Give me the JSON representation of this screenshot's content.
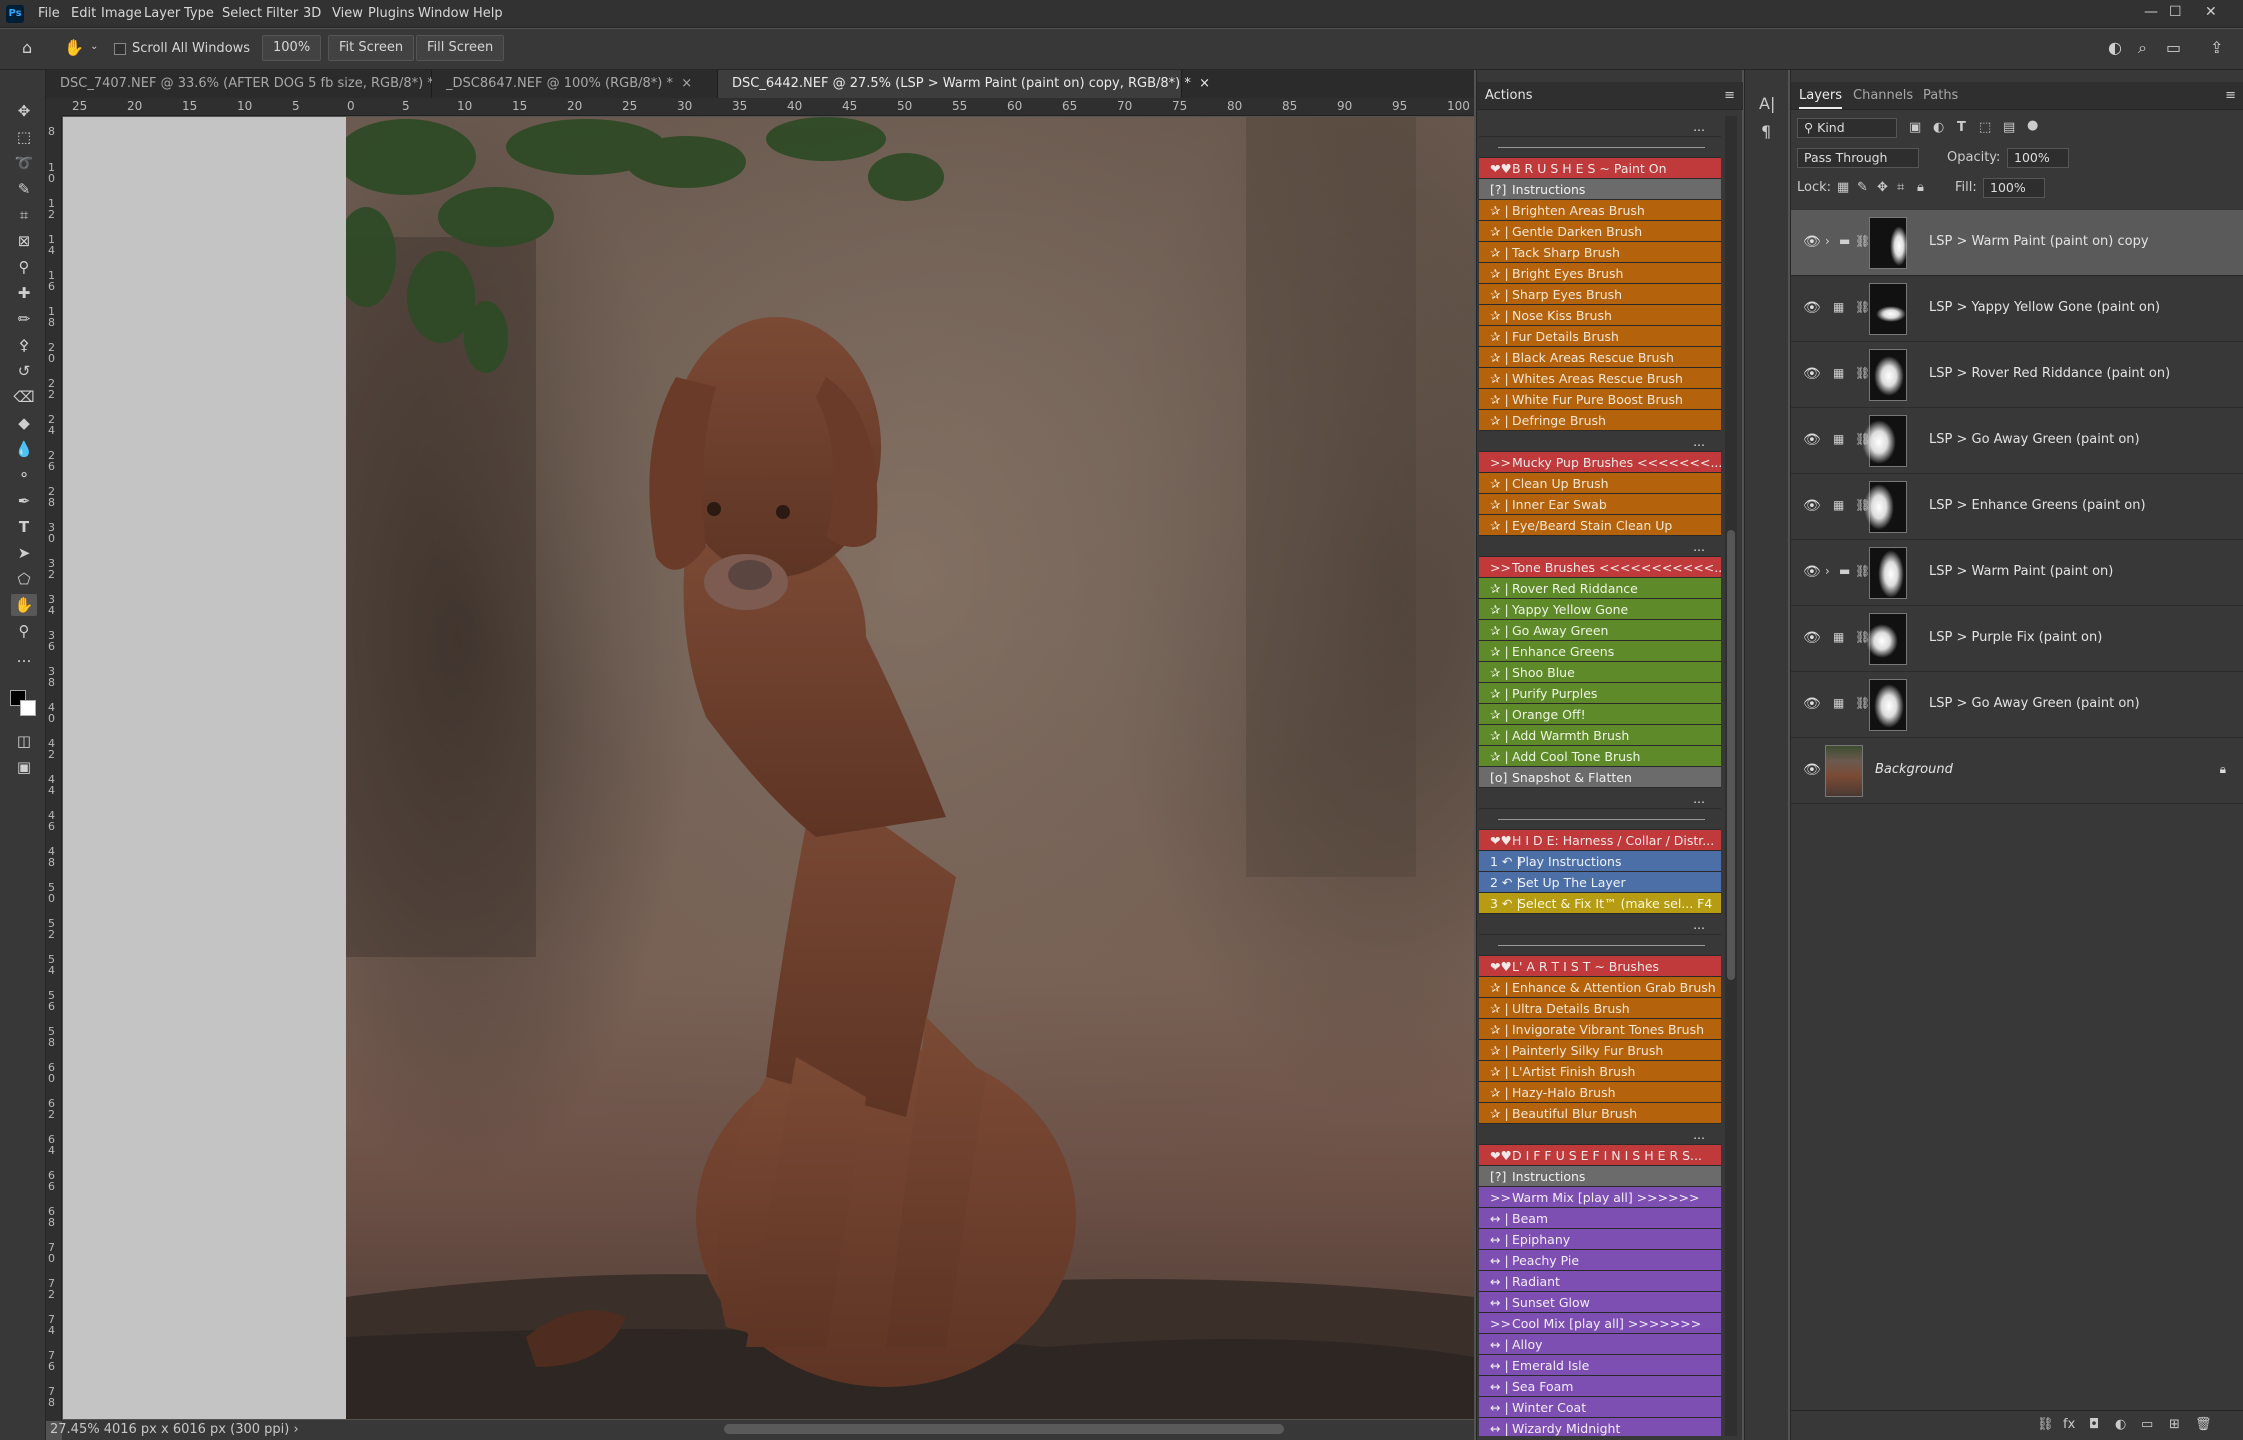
{
  "menu": [
    "File",
    "Edit",
    "Image",
    "Layer",
    "Type",
    "Select",
    "Filter",
    "3D",
    "View",
    "Plugins",
    "Window",
    "Help"
  ],
  "options": {
    "scroll_all_windows": "Scroll All Windows",
    "zoom": "100%",
    "fit_screen": "Fit Screen",
    "fill_screen": "Fill Screen"
  },
  "tabs": [
    {
      "label": "DSC_7407.NEF @ 33.6% (AFTER DOG 5 fb size, RGB/8*) *",
      "close": "×",
      "active": false
    },
    {
      "label": "_DSC8647.NEF @ 100% (RGB/8*) *",
      "close": "×",
      "active": false
    },
    {
      "label": "DSC_6442.NEF @ 27.5% (LSP > Warm Paint (paint on) copy, RGB/8*) *",
      "close": "×",
      "active": true
    }
  ],
  "ruler_h": [
    "25",
    "20",
    "15",
    "10",
    "5",
    "0",
    "5",
    "10",
    "15",
    "20",
    "25",
    "30",
    "35",
    "40",
    "45",
    "50",
    "55",
    "60",
    "65",
    "70",
    "75",
    "80",
    "85",
    "90",
    "95",
    "100"
  ],
  "ruler_v": [
    "8",
    "1 0",
    "1 2",
    "1 4",
    "1 6",
    "1 8",
    "2 0",
    "2 2",
    "2 4",
    "2 6",
    "2 8",
    "3 0",
    "3 2",
    "3 4",
    "3 6",
    "3 8",
    "4 0",
    "4 2",
    "4 4",
    "4 6",
    "4 8",
    "5 0",
    "5 2",
    "5 4",
    "5 6",
    "5 8",
    "6 0",
    "6 2",
    "6 4",
    "6 6",
    "6 8",
    "7 0",
    "7 2",
    "7 4",
    "7 6",
    "7 8"
  ],
  "status": {
    "zoom": "27.45%",
    "dimensions": "4016 px x 6016 px (300 ppi)",
    "arrow": "›"
  },
  "actions": {
    "title": "Actions",
    "rows": [
      {
        "c": "dots",
        "t": "...",
        "k": ""
      },
      {
        "c": "line",
        "t": "",
        "k": ""
      },
      {
        "c": "red",
        "k": "❤♥",
        "t": "B R U S H E S  ~ Paint On"
      },
      {
        "c": "gray",
        "k": "[?]",
        "t": "Instructions"
      },
      {
        "c": "orange",
        "k": "✰ |",
        "t": "Brighten Areas Brush"
      },
      {
        "c": "orange",
        "k": "✰ |",
        "t": "Gentle Darken Brush"
      },
      {
        "c": "orange",
        "k": "✰ |",
        "t": "Tack Sharp Brush"
      },
      {
        "c": "orange",
        "k": "✰ |",
        "t": "Bright Eyes Brush"
      },
      {
        "c": "orange",
        "k": "✰ |",
        "t": "Sharp Eyes Brush"
      },
      {
        "c": "orange",
        "k": "✰ |",
        "t": "Nose Kiss Brush"
      },
      {
        "c": "orange",
        "k": "✰ |",
        "t": "Fur Details Brush"
      },
      {
        "c": "orange",
        "k": "✰ |",
        "t": "Black Areas Rescue Brush"
      },
      {
        "c": "orange",
        "k": "✰ |",
        "t": "Whites Areas Rescue Brush"
      },
      {
        "c": "orange",
        "k": "✰ |",
        "t": "White Fur Pure Boost Brush"
      },
      {
        "c": "orange",
        "k": "✰ |",
        "t": "Defringe Brush"
      },
      {
        "c": "dots",
        "t": "...",
        "k": ""
      },
      {
        "c": "red",
        "k": ">>",
        "t": "Mucky Pup Brushes <<<<<<<..."
      },
      {
        "c": "orange",
        "k": "✰ |",
        "t": "Clean Up Brush"
      },
      {
        "c": "orange",
        "k": "✰ |",
        "t": "Inner Ear Swab"
      },
      {
        "c": "orange",
        "k": "✰ |",
        "t": "Eye/Beard Stain Clean Up"
      },
      {
        "c": "dots",
        "t": "...",
        "k": ""
      },
      {
        "c": "red",
        "k": ">>",
        "t": "Tone Brushes <<<<<<<<<<<..."
      },
      {
        "c": "green",
        "k": "✰ |",
        "t": "Rover Red Riddance"
      },
      {
        "c": "green",
        "k": "✰ |",
        "t": "Yappy Yellow Gone"
      },
      {
        "c": "green",
        "k": "✰ |",
        "t": "Go Away Green"
      },
      {
        "c": "green",
        "k": "✰ |",
        "t": "Enhance Greens"
      },
      {
        "c": "green",
        "k": "✰ |",
        "t": "Shoo Blue"
      },
      {
        "c": "green",
        "k": "✰ |",
        "t": "Purify Purples"
      },
      {
        "c": "green",
        "k": "✰ |",
        "t": "Orange Off!"
      },
      {
        "c": "green",
        "k": "✰ |",
        "t": "Add Warmth Brush"
      },
      {
        "c": "green",
        "k": "✰ |",
        "t": "Add Cool Tone Brush"
      },
      {
        "c": "gray",
        "k": "[o]",
        "t": "Snapshot & Flatten"
      },
      {
        "c": "dots",
        "t": "...",
        "k": ""
      },
      {
        "c": "line",
        "t": "",
        "k": ""
      },
      {
        "c": "red",
        "k": "❤♥",
        "t": "H I D E: Harness / Collar / Distr..."
      },
      {
        "c": "blue",
        "k": "1 ↶ |",
        "t": "Play Instructions"
      },
      {
        "c": "blue",
        "k": "2 ↶ |",
        "t": "Set Up The Layer"
      },
      {
        "c": "yellow",
        "k": "3 ↶ |",
        "t": "Select & Fix It™ (make sel...      F4"
      },
      {
        "c": "dots",
        "t": "...",
        "k": ""
      },
      {
        "c": "line",
        "t": "",
        "k": ""
      },
      {
        "c": "red",
        "k": "❤♥",
        "t": "L' A R T I S T  ~ Brushes"
      },
      {
        "c": "orange",
        "k": "✰ |",
        "t": "Enhance & Attention Grab Brush"
      },
      {
        "c": "orange",
        "k": "✰ |",
        "t": "Ultra Details Brush"
      },
      {
        "c": "orange",
        "k": "✰ |",
        "t": "Invigorate Vibrant Tones Brush"
      },
      {
        "c": "orange",
        "k": "✰ |",
        "t": "Painterly Silky Fur Brush"
      },
      {
        "c": "orange",
        "k": "✰ |",
        "t": "L'Artist Finish Brush"
      },
      {
        "c": "orange",
        "k": "✰ |",
        "t": "Hazy-Halo Brush"
      },
      {
        "c": "orange",
        "k": "✰ |",
        "t": "Beautiful Blur Brush"
      },
      {
        "c": "dots",
        "t": "...",
        "k": ""
      },
      {
        "c": "red",
        "k": "❤♥",
        "t": "D I F F U S E  F I N I S H E R S..."
      },
      {
        "c": "gray",
        "k": "[?]",
        "t": "Instructions"
      },
      {
        "c": "purple",
        "k": ">>",
        "t": "Warm Mix [play all] >>>>>>"
      },
      {
        "c": "purple",
        "k": "↔ |",
        "t": "Beam"
      },
      {
        "c": "purple",
        "k": "↔ |",
        "t": "Epiphany"
      },
      {
        "c": "purple",
        "k": "↔ |",
        "t": "Peachy Pie"
      },
      {
        "c": "purple",
        "k": "↔ |",
        "t": "Radiant"
      },
      {
        "c": "purple",
        "k": "↔ |",
        "t": "Sunset Glow"
      },
      {
        "c": "purple",
        "k": ">>",
        "t": "Cool Mix [play all] >>>>>>>"
      },
      {
        "c": "purple",
        "k": "↔ |",
        "t": "Alloy"
      },
      {
        "c": "purple",
        "k": "↔ |",
        "t": "Emerald Isle"
      },
      {
        "c": "purple",
        "k": "↔ |",
        "t": "Sea Foam"
      },
      {
        "c": "purple",
        "k": "↔ |",
        "t": "Winter Coat"
      },
      {
        "c": "purple",
        "k": "↔ |",
        "t": "Wizardy Midnight"
      }
    ]
  },
  "layers": {
    "tabs": [
      "Layers",
      "Channels",
      "Paths"
    ],
    "filter": "Kind",
    "blend": "Pass Through",
    "opacity_label": "Opacity:",
    "opacity": "100%",
    "lock_label": "Lock:",
    "fill_label": "Fill:",
    "fill": "100%",
    "items": [
      {
        "name": "LSP > Warm Paint (paint on) copy",
        "kind": "group",
        "selected": true
      },
      {
        "name": "LSP > Yappy Yellow Gone (paint on)",
        "kind": "adjustment",
        "selected": false
      },
      {
        "name": "LSP > Rover Red Riddance (paint on)",
        "kind": "adjustment",
        "selected": false
      },
      {
        "name": "LSP > Go Away Green (paint on)",
        "kind": "adjustment",
        "selected": false
      },
      {
        "name": "LSP > Enhance Greens (paint on)",
        "kind": "adjustment",
        "selected": false
      },
      {
        "name": "LSP > Warm Paint (paint on)",
        "kind": "group",
        "selected": false
      },
      {
        "name": "LSP > Purple Fix (paint on)",
        "kind": "adjustment",
        "selected": false
      },
      {
        "name": "LSP > Go Away Green (paint on)",
        "kind": "adjustment",
        "selected": false
      },
      {
        "name": "Background",
        "kind": "background",
        "selected": false
      }
    ]
  }
}
